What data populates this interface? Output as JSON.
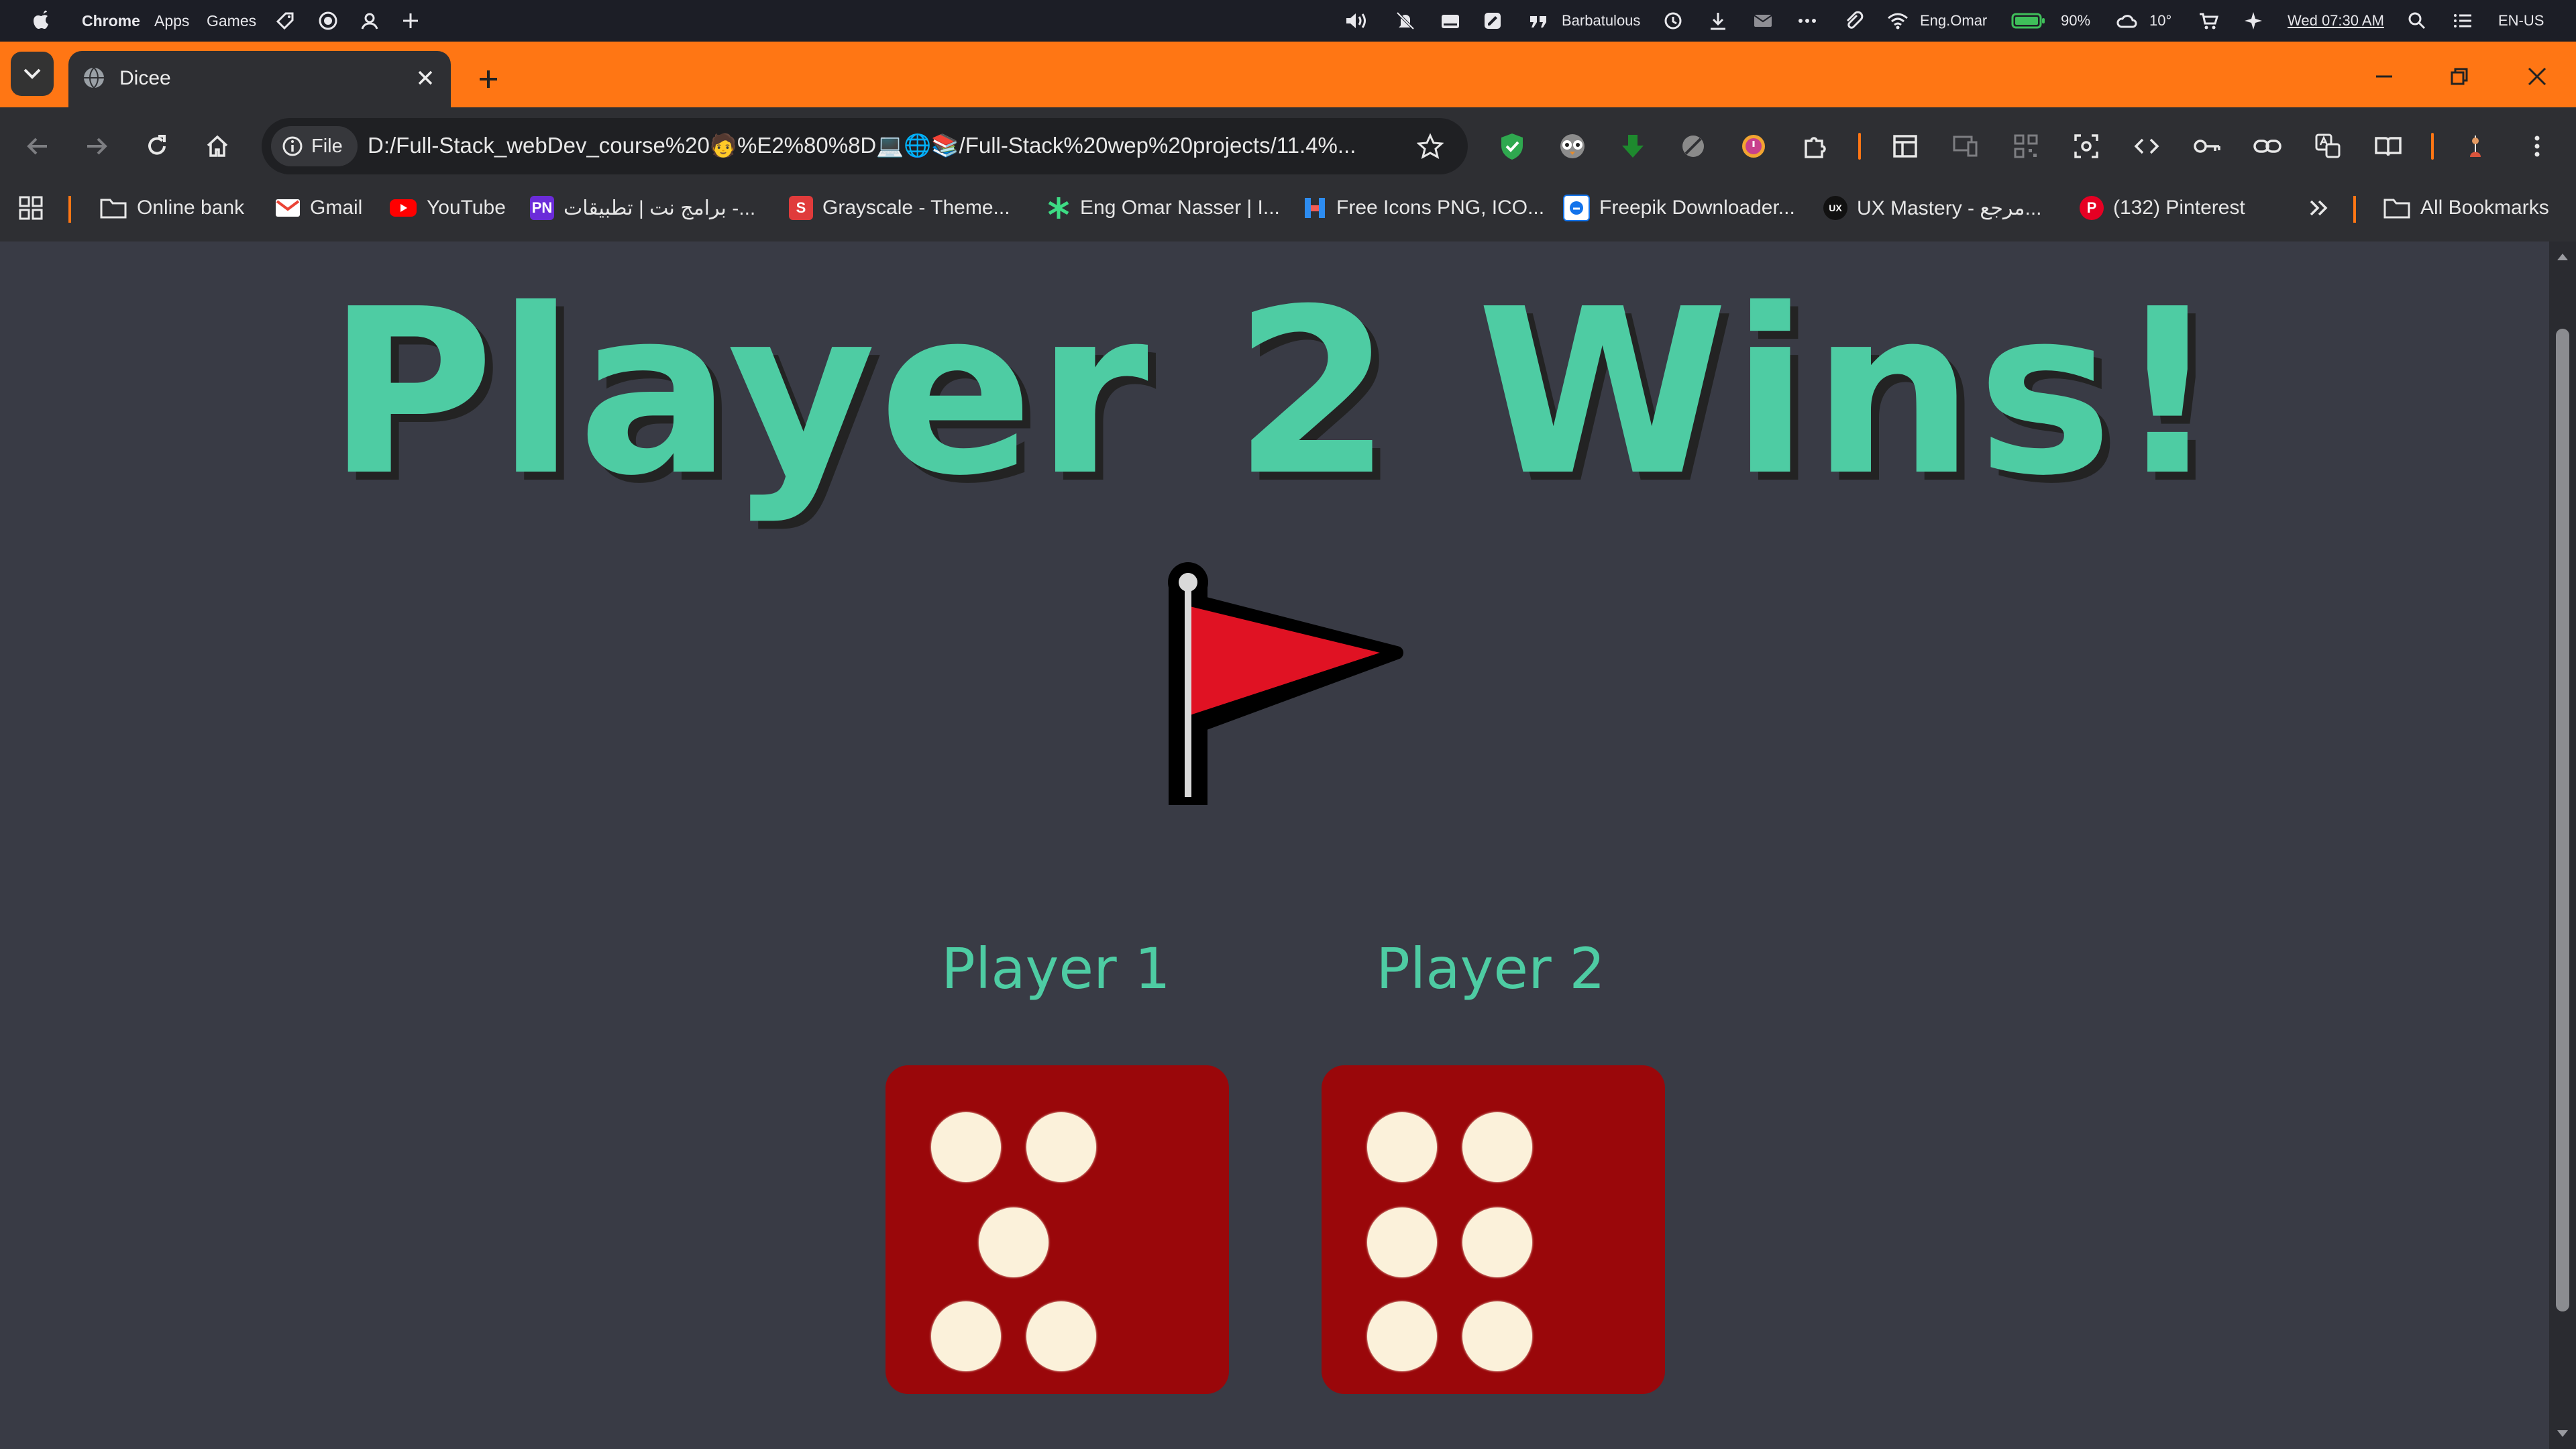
{
  "menubar": {
    "app_name": "Chrome",
    "menus": [
      "Apps",
      "Games"
    ],
    "wifi_name": "Barbatulous",
    "user_name": "Eng.Omar",
    "battery": "90%",
    "weather": "10°",
    "clock": "Wed 07:30 AM",
    "input_lang": "EN-US"
  },
  "tab": {
    "title": "Dicee"
  },
  "omnibox": {
    "chip_label": "File",
    "url": "D:/Full-Stack_webDev_course%20🧑%E2%80%8D💻🌐📚/Full-Stack%20wep%20projects/11.4%..."
  },
  "bookmarks": {
    "items": [
      {
        "label": "Online bank",
        "icon": "folder-icon"
      },
      {
        "label": "Gmail",
        "icon": "gmail-icon",
        "color": "#EA4335"
      },
      {
        "label": "YouTube",
        "icon": "youtube-icon",
        "color": "#FF0000"
      },
      {
        "label": "برامج نت | تطبيقات -...",
        "icon": "barmej-icon",
        "color": "#6B2BD9"
      },
      {
        "label": "Grayscale - Theme...",
        "icon": "grayscale-icon",
        "color": "#E03B3B"
      },
      {
        "label": "Eng Omar Nasser | I...",
        "icon": "asterisk-icon",
        "color": "#3DDC84"
      },
      {
        "label": "Free Icons PNG, ICO...",
        "icon": "freeicons-icon",
        "color": "#2D8CF0"
      },
      {
        "label": "Freepik Downloader...",
        "icon": "freepik-icon",
        "color": "#1273EB"
      },
      {
        "label": "UX Mastery - مرجع...",
        "icon": "uxmastery-icon",
        "color": "#111111"
      },
      {
        "label": "(132) Pinterest",
        "icon": "pinterest-icon",
        "color": "#E60023"
      }
    ],
    "all_bookmarks": "All Bookmarks"
  },
  "page": {
    "headline": "Player 2 Wins!",
    "player1_label": "Player 1",
    "player2_label": "Player 2",
    "player1_roll": 5,
    "player2_roll": 6,
    "accent_color": "#4ECCA3",
    "die_color": "#9A070A",
    "background_color": "#393B45"
  }
}
